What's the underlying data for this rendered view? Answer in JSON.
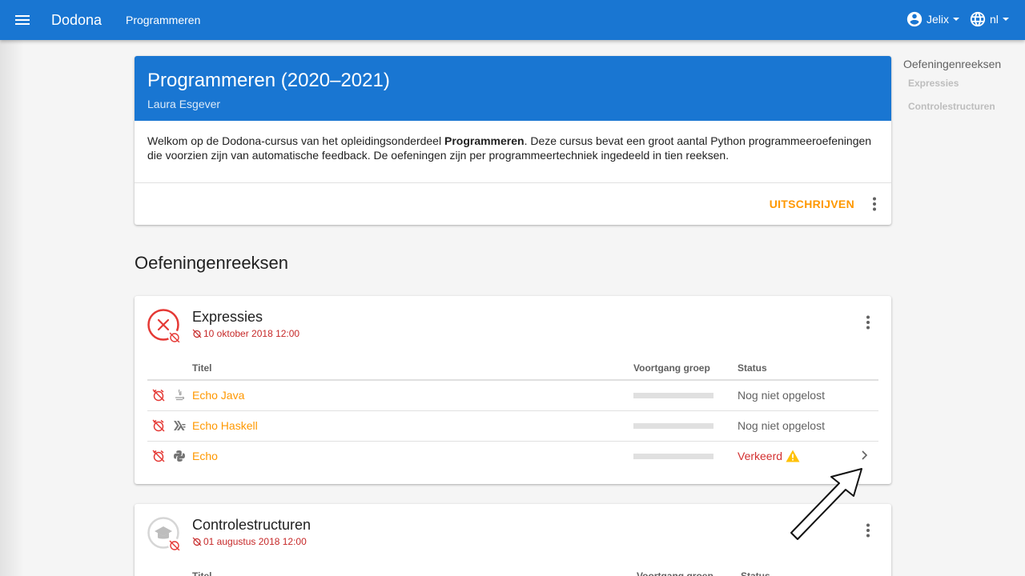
{
  "topbar": {
    "brand": "Dodona",
    "breadcrumb": "Programmeren",
    "user": "Jelix",
    "language": "nl",
    "icons": [
      "menu-icon",
      "account-circle-icon",
      "globe-icon",
      "caret-down-icon"
    ]
  },
  "course": {
    "title": "Programmeren (2020–2021)",
    "teacher": "Laura Esgever",
    "description_pre": "Welkom op de Dodona-cursus van het opleidingsonderdeel ",
    "description_bold": "Programmeren",
    "description_post": ". Deze cursus bevat een groot aantal Python programmeeroefeningen die voorzien zijn van automatische feedback. De oefeningen zijn per programmeertechniek ingedeeld in tien reeksen.",
    "unsubscribe": "UITSCHRIJVEN"
  },
  "section_title": "Oefeningenreeksen",
  "table_headers": {
    "title": "Titel",
    "progress": "Voortgang groep",
    "status": "Status"
  },
  "series": [
    {
      "name": "Expressies",
      "deadline": "10 oktober 2018 12:00",
      "status_icon": "wrong-circle-icon",
      "exercises": [
        {
          "language_icon": "java-icon",
          "name": "Echo Java",
          "progress": 0,
          "status": "Nog niet opgelost"
        },
        {
          "language_icon": "haskell-icon",
          "name": "Echo Haskell",
          "progress": 0,
          "status": "Nog niet opgelost"
        },
        {
          "language_icon": "python-icon",
          "name": "Echo",
          "progress": 0,
          "status": "Verkeerd"
        }
      ]
    },
    {
      "name": "Controlestructuren",
      "deadline": "01 augustus 2018 12:00",
      "status_icon": "graduation-cap-icon"
    }
  ],
  "toc": {
    "title": "Oefeningenreeksen",
    "items": [
      "Expressies",
      "Controlestructuren"
    ]
  },
  "colors": {
    "primary": "#1976d2",
    "accent": "#ff9800",
    "error": "#d32f2f",
    "warning": "#ffc107"
  }
}
